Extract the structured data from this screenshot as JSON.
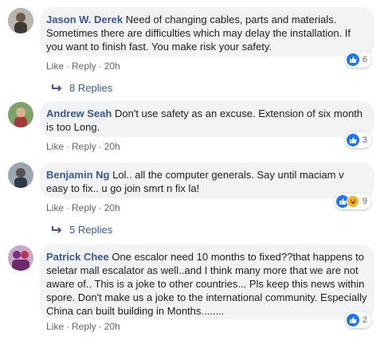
{
  "comments": [
    {
      "name": "Jason W. Derek",
      "text": "Need of changing cables, parts and materials. Sometimes there are difficulties which may delay the installation. If you want to finish fast. You make risk your safety.",
      "like": "Like",
      "reply": "Reply",
      "time": "20h",
      "reaction_count": "6"
    },
    {
      "name": "Andrew Seah",
      "text": "Don't use safety as an excuse. Extension of six month is too Long.",
      "like": "Like",
      "reply": "Reply",
      "time": "20h",
      "reaction_count": "3"
    },
    {
      "name": "Benjamin Ng",
      "text": "Lol.. all the computer generals. Say until maciam v easy to fix.. u go join smrt n fix la!",
      "like": "Like",
      "reply": "Reply",
      "time": "20h",
      "reaction_count": "9"
    },
    {
      "name": "Patrick Chee",
      "text": "One escalor need 10 months to fixed??that happens to seletar mall escalator as well..and I think many more that we are not aware of.. This is a joke to other countries... Pls keep this news within spore. Don't make us a joke to the international community. Especially China can built building in Months........",
      "like": "Like",
      "reply": "Reply",
      "time": "20h",
      "reaction_count": "2"
    }
  ],
  "replies": [
    {
      "label": "8 Replies"
    },
    {
      "label": "5 Replies"
    }
  ],
  "colors": {
    "name": "#385898",
    "bubble": "#f2f3f5",
    "like": "#1877f2",
    "haha": "#f7b125"
  }
}
